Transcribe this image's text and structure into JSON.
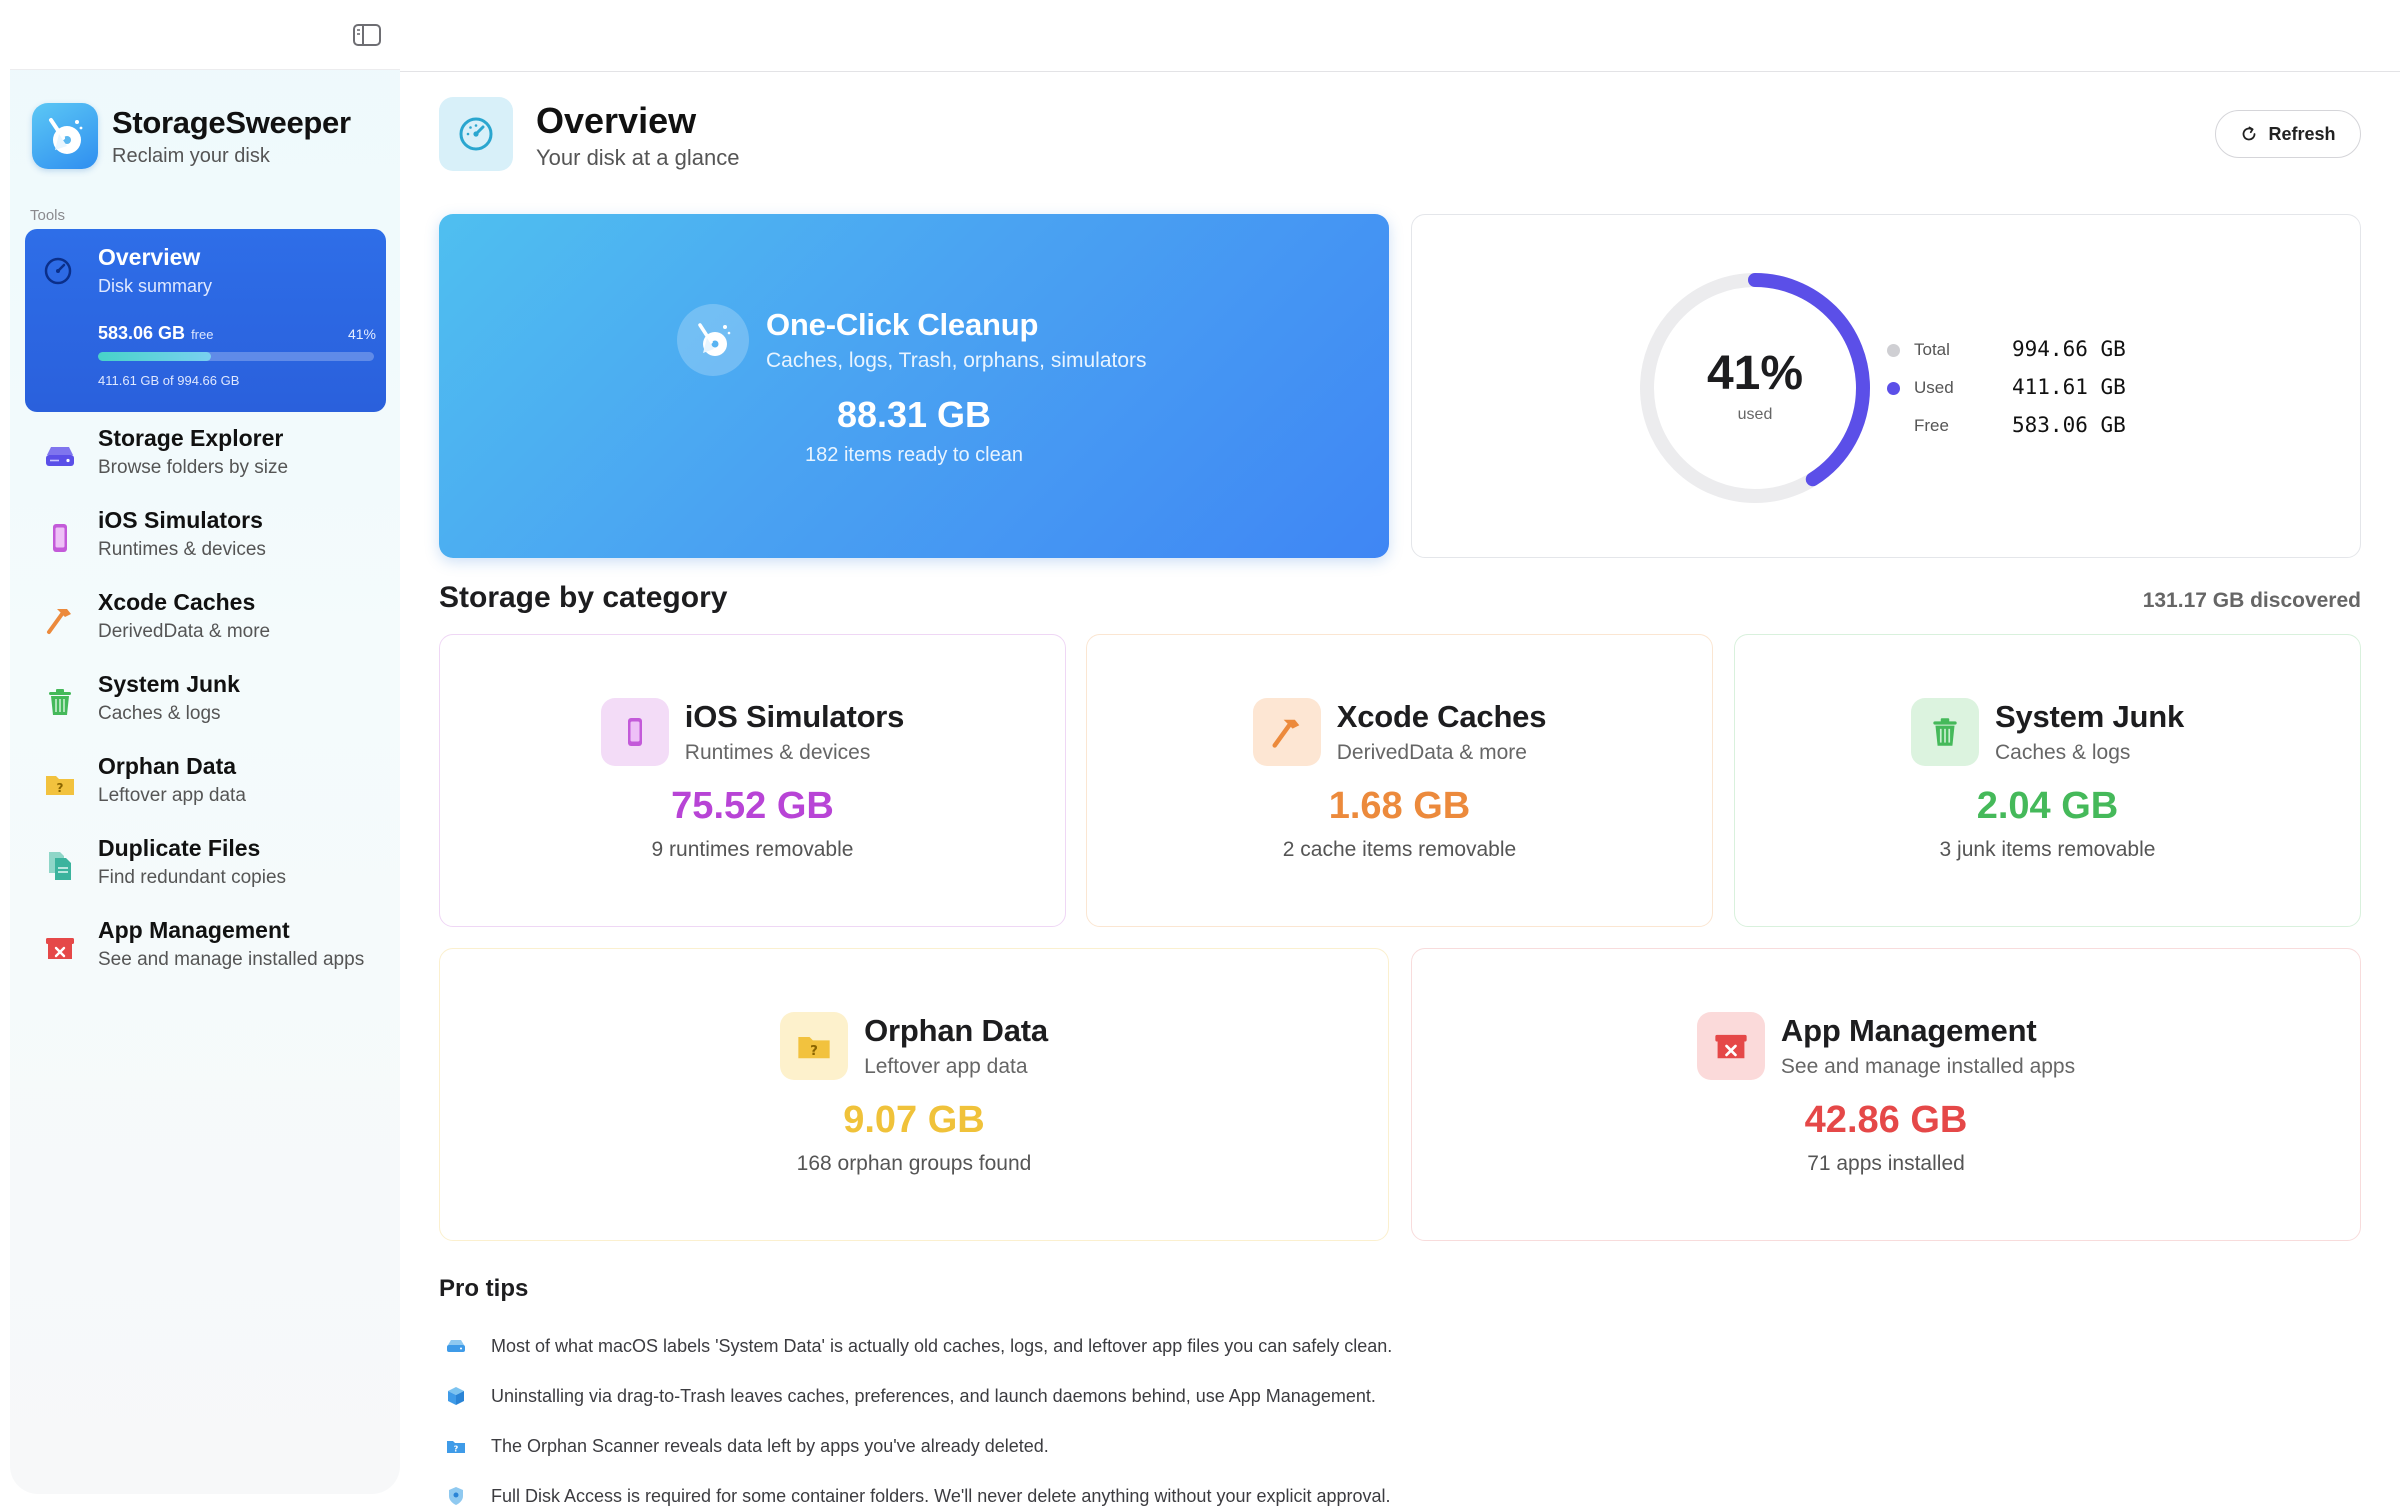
{
  "app": {
    "name": "StorageSweeper",
    "tagline": "Reclaim your disk"
  },
  "sidebar": {
    "section_label": "Tools",
    "active": {
      "title": "Overview",
      "subtitle": "Disk summary",
      "free": "583.06 GB",
      "free_suffix": "free",
      "percent": "41%",
      "used_fraction": 0.41,
      "used_text": "411.61 GB of 994.66 GB"
    },
    "items": [
      {
        "title": "Storage Explorer",
        "subtitle": "Browse folders by size",
        "icon": "drive-icon"
      },
      {
        "title": "iOS Simulators",
        "subtitle": "Runtimes & devices",
        "icon": "phone-icon"
      },
      {
        "title": "Xcode Caches",
        "subtitle": "DerivedData & more",
        "icon": "hammer-icon"
      },
      {
        "title": "System Junk",
        "subtitle": "Caches & logs",
        "icon": "trash-icon"
      },
      {
        "title": "Orphan Data",
        "subtitle": "Leftover app data",
        "icon": "question-folder-icon"
      },
      {
        "title": "Duplicate Files",
        "subtitle": "Find redundant copies",
        "icon": "documents-icon"
      },
      {
        "title": "App Management",
        "subtitle": "See and manage installed apps",
        "icon": "app-remove-icon"
      }
    ]
  },
  "header": {
    "title": "Overview",
    "subtitle": "Your disk at a glance",
    "refresh_label": "Refresh"
  },
  "cleanup": {
    "title": "One-Click Cleanup",
    "subtitle": "Caches, logs, Trash, orphans, simulators",
    "size": "88.31 GB",
    "note": "182 items ready to clean"
  },
  "usage": {
    "percent": "41%",
    "used_fraction": 0.41,
    "label": "used",
    "legend": [
      {
        "key": "Total",
        "value": "994.66 GB",
        "color": "#cfcfd3"
      },
      {
        "key": "Used",
        "value": "411.61 GB",
        "color": "#5b4fe8"
      },
      {
        "key": "Free",
        "value": "583.06 GB",
        "color": "#ffffff"
      }
    ]
  },
  "categories": {
    "title": "Storage by category",
    "discovered": "131.17 GB discovered",
    "items": [
      {
        "name": "iOS Simulators",
        "subtitle": "Runtimes & devices",
        "value": "75.52 GB",
        "note": "9 runtimes removable",
        "color": "#b844d6",
        "bg": "#f3dcf7",
        "border": "#efd7f5"
      },
      {
        "name": "Xcode Caches",
        "subtitle": "DerivedData & more",
        "value": "1.68 GB",
        "note": "2 cache items removable",
        "color": "#ec8a3c",
        "bg": "#fde6d3",
        "border": "#fbe6d2"
      },
      {
        "name": "System Junk",
        "subtitle": "Caches & logs",
        "value": "2.04 GB",
        "note": "3 junk items removable",
        "color": "#45b95a",
        "bg": "#dcf3df",
        "border": "#d9f1dd"
      },
      {
        "name": "Orphan Data",
        "subtitle": "Leftover app data",
        "value": "9.07 GB",
        "note": "168 orphan groups found",
        "color": "#f0c23a",
        "bg": "#fdf1cc",
        "border": "#fbf0cf"
      },
      {
        "name": "App Management",
        "subtitle": "See and manage installed apps",
        "value": "42.86 GB",
        "note": "71 apps installed",
        "color": "#e54848",
        "bg": "#fbdada",
        "border": "#f8dcdc"
      }
    ]
  },
  "tips": {
    "title": "Pro tips",
    "items": [
      {
        "text": "Most of what macOS labels 'System Data' is actually old caches, logs, and leftover app files you can safely clean.",
        "icon": "drive-icon"
      },
      {
        "text": "Uninstalling via drag-to-Trash leaves caches, preferences, and launch daemons behind, use App Management.",
        "icon": "box-icon"
      },
      {
        "text": "The Orphan Scanner reveals data left by apps you've already deleted.",
        "icon": "question-folder-icon"
      },
      {
        "text": "Full Disk Access is required for some container folders. We'll never delete anything without your explicit approval.",
        "icon": "shield-icon"
      }
    ]
  }
}
